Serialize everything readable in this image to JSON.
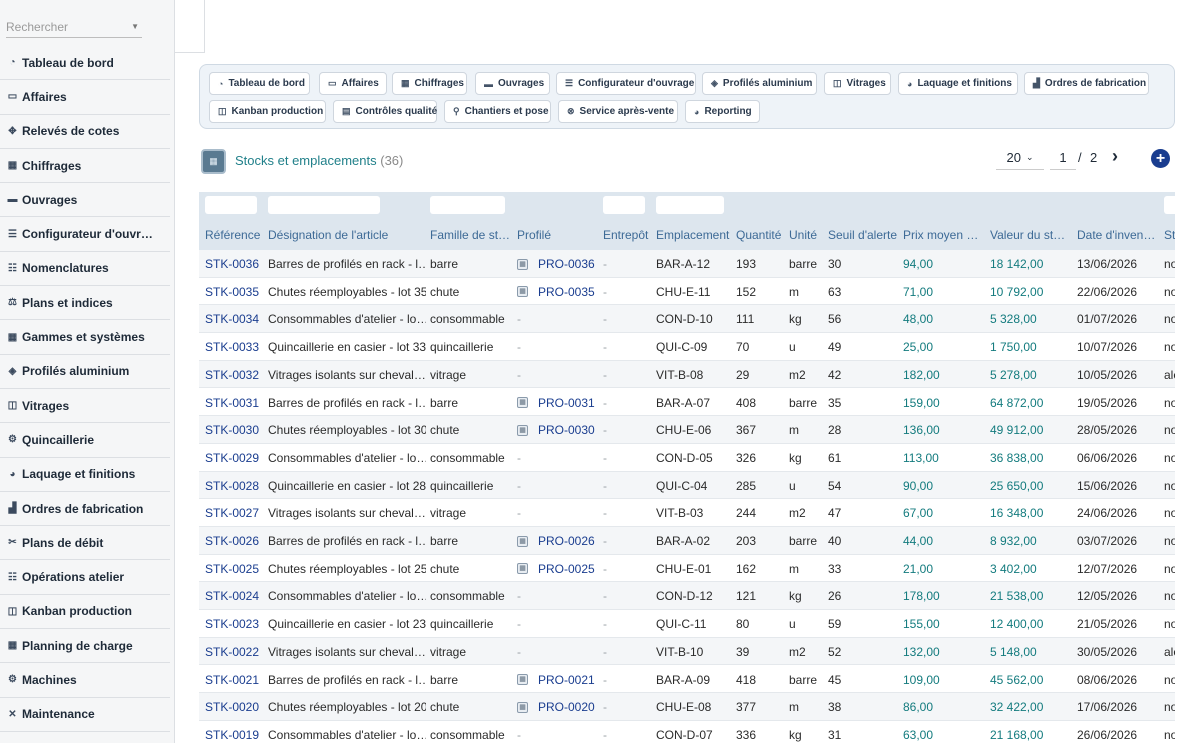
{
  "sidebar": {
    "search_placeholder": "Rechercher",
    "items": [
      {
        "label": "Tableau de bord",
        "icon": "dashboard-icon",
        "glyph": "◔"
      },
      {
        "label": "Affaires",
        "icon": "briefcase-icon",
        "glyph": "▭"
      },
      {
        "label": "Relevés de cotes",
        "icon": "measure-icon",
        "glyph": "✥"
      },
      {
        "label": "Chiffrages",
        "icon": "calculator-icon",
        "glyph": "▦"
      },
      {
        "label": "Ouvrages",
        "icon": "window-icon",
        "glyph": "▬"
      },
      {
        "label": "Configurateur d'ouvr…",
        "icon": "sliders-icon",
        "glyph": "☰"
      },
      {
        "label": "Nomenclatures",
        "icon": "list-icon",
        "glyph": "☷"
      },
      {
        "label": "Plans et indices",
        "icon": "drafting-icon",
        "glyph": "⚖"
      },
      {
        "label": "Gammes et systèmes",
        "icon": "grid-icon",
        "glyph": "▦"
      },
      {
        "label": "Profilés aluminium",
        "icon": "layers-icon",
        "glyph": "◈"
      },
      {
        "label": "Vitrages",
        "icon": "glass-icon",
        "glyph": "◫"
      },
      {
        "label": "Quincaillerie",
        "icon": "cogs-icon",
        "glyph": "⚙"
      },
      {
        "label": "Laquage et finitions",
        "icon": "palette-icon",
        "glyph": "◕"
      },
      {
        "label": "Ordres de fabrication",
        "icon": "factory-icon",
        "glyph": "▟"
      },
      {
        "label": "Plans de débit",
        "icon": "scissors-icon",
        "glyph": "✂"
      },
      {
        "label": "Opérations atelier",
        "icon": "tasks-icon",
        "glyph": "☷"
      },
      {
        "label": "Kanban production",
        "icon": "kanban-icon",
        "glyph": "◫"
      },
      {
        "label": "Planning de charge",
        "icon": "calendar-icon",
        "glyph": "▦"
      },
      {
        "label": "Machines",
        "icon": "cogs-icon",
        "glyph": "⚙"
      },
      {
        "label": "Maintenance",
        "icon": "tools-icon",
        "glyph": "✕"
      }
    ]
  },
  "nav": {
    "row1": [
      {
        "label": "Tableau de bord",
        "icon": "dashboard-icon",
        "glyph": "◔"
      },
      {
        "label": "Affaires",
        "icon": "briefcase-icon",
        "glyph": "▭"
      },
      {
        "label": "Chiffrages",
        "icon": "calculator-icon",
        "glyph": "▦"
      },
      {
        "label": "Ouvrages",
        "icon": "window-icon",
        "glyph": "▬"
      },
      {
        "label": "Configurateur d'ouvrage",
        "icon": "sliders-icon",
        "glyph": "☰"
      },
      {
        "label": "Profilés aluminium",
        "icon": "layers-icon",
        "glyph": "◈"
      },
      {
        "label": "Vitrages",
        "icon": "glass-icon",
        "glyph": "◫"
      },
      {
        "label": "Laquage et finitions",
        "icon": "palette-icon",
        "glyph": "◕"
      },
      {
        "label": "Ordres de fabrication",
        "icon": "factory-icon",
        "glyph": "▟"
      }
    ],
    "row2": [
      {
        "label": "Kanban production",
        "icon": "kanban-icon",
        "glyph": "◫"
      },
      {
        "label": "Contrôles qualité",
        "icon": "clipboard-icon",
        "glyph": "▤"
      },
      {
        "label": "Chantiers et pose",
        "icon": "map-pin-icon",
        "glyph": "⚲"
      },
      {
        "label": "Service après-vente",
        "icon": "support-icon",
        "glyph": "⊗"
      },
      {
        "label": "Reporting",
        "icon": "chart-pie-icon",
        "glyph": "◕"
      }
    ]
  },
  "list": {
    "title": "Stocks et emplacements",
    "count": "(36)",
    "page_size": "20",
    "page_current": "1",
    "page_sep": "/",
    "page_total": "2"
  },
  "table": {
    "headers": [
      "Référence",
      "Désignation de l'article",
      "Famille de st…",
      "Profilé",
      "Entrepôt",
      "Emplacement",
      "Quantité",
      "Unité",
      "Seuil d'alerte",
      "Prix moyen …",
      "Valeur du st…",
      "Date d'inven…",
      "St"
    ],
    "rows": [
      {
        "ref": "STK-0036",
        "des": "Barres de profilés en rack - l…",
        "fam": "barre",
        "prof": "PRO-0036",
        "ent": "-",
        "emp": "BAR-A-12",
        "qte": "193",
        "unit": "barre",
        "seuil": "30",
        "prix": "94,00",
        "val": "18 142,00",
        "date": "13/06/2026",
        "st": "no"
      },
      {
        "ref": "STK-0035",
        "des": "Chutes réemployables - lot 35",
        "fam": "chute",
        "prof": "PRO-0035",
        "ent": "-",
        "emp": "CHU-E-11",
        "qte": "152",
        "unit": "m",
        "seuil": "63",
        "prix": "71,00",
        "val": "10 792,00",
        "date": "22/06/2026",
        "st": "no"
      },
      {
        "ref": "STK-0034",
        "des": "Consommables d'atelier - lo…",
        "fam": "consommable",
        "prof": "-",
        "ent": "-",
        "emp": "CON-D-10",
        "qte": "111",
        "unit": "kg",
        "seuil": "56",
        "prix": "48,00",
        "val": "5 328,00",
        "date": "01/07/2026",
        "st": "no"
      },
      {
        "ref": "STK-0033",
        "des": "Quincaillerie en casier - lot 33",
        "fam": "quincaillerie",
        "prof": "-",
        "ent": "-",
        "emp": "QUI-C-09",
        "qte": "70",
        "unit": "u",
        "seuil": "49",
        "prix": "25,00",
        "val": "1 750,00",
        "date": "10/07/2026",
        "st": "no"
      },
      {
        "ref": "STK-0032",
        "des": "Vitrages isolants sur cheval…",
        "fam": "vitrage",
        "prof": "-",
        "ent": "-",
        "emp": "VIT-B-08",
        "qte": "29",
        "unit": "m2",
        "seuil": "42",
        "prix": "182,00",
        "val": "5 278,00",
        "date": "10/05/2026",
        "st": "ale"
      },
      {
        "ref": "STK-0031",
        "des": "Barres de profilés en rack - l…",
        "fam": "barre",
        "prof": "PRO-0031",
        "ent": "-",
        "emp": "BAR-A-07",
        "qte": "408",
        "unit": "barre",
        "seuil": "35",
        "prix": "159,00",
        "val": "64 872,00",
        "date": "19/05/2026",
        "st": "no"
      },
      {
        "ref": "STK-0030",
        "des": "Chutes réemployables - lot 30",
        "fam": "chute",
        "prof": "PRO-0030",
        "ent": "-",
        "emp": "CHU-E-06",
        "qte": "367",
        "unit": "m",
        "seuil": "28",
        "prix": "136,00",
        "val": "49 912,00",
        "date": "28/05/2026",
        "st": "no"
      },
      {
        "ref": "STK-0029",
        "des": "Consommables d'atelier - lo…",
        "fam": "consommable",
        "prof": "-",
        "ent": "-",
        "emp": "CON-D-05",
        "qte": "326",
        "unit": "kg",
        "seuil": "61",
        "prix": "113,00",
        "val": "36 838,00",
        "date": "06/06/2026",
        "st": "no"
      },
      {
        "ref": "STK-0028",
        "des": "Quincaillerie en casier - lot 28",
        "fam": "quincaillerie",
        "prof": "-",
        "ent": "-",
        "emp": "QUI-C-04",
        "qte": "285",
        "unit": "u",
        "seuil": "54",
        "prix": "90,00",
        "val": "25 650,00",
        "date": "15/06/2026",
        "st": "no"
      },
      {
        "ref": "STK-0027",
        "des": "Vitrages isolants sur cheval…",
        "fam": "vitrage",
        "prof": "-",
        "ent": "-",
        "emp": "VIT-B-03",
        "qte": "244",
        "unit": "m2",
        "seuil": "47",
        "prix": "67,00",
        "val": "16 348,00",
        "date": "24/06/2026",
        "st": "no"
      },
      {
        "ref": "STK-0026",
        "des": "Barres de profilés en rack - l…",
        "fam": "barre",
        "prof": "PRO-0026",
        "ent": "-",
        "emp": "BAR-A-02",
        "qte": "203",
        "unit": "barre",
        "seuil": "40",
        "prix": "44,00",
        "val": "8 932,00",
        "date": "03/07/2026",
        "st": "no"
      },
      {
        "ref": "STK-0025",
        "des": "Chutes réemployables - lot 25",
        "fam": "chute",
        "prof": "PRO-0025",
        "ent": "-",
        "emp": "CHU-E-01",
        "qte": "162",
        "unit": "m",
        "seuil": "33",
        "prix": "21,00",
        "val": "3 402,00",
        "date": "12/07/2026",
        "st": "no"
      },
      {
        "ref": "STK-0024",
        "des": "Consommables d'atelier - lo…",
        "fam": "consommable",
        "prof": "-",
        "ent": "-",
        "emp": "CON-D-12",
        "qte": "121",
        "unit": "kg",
        "seuil": "26",
        "prix": "178,00",
        "val": "21 538,00",
        "date": "12/05/2026",
        "st": "no"
      },
      {
        "ref": "STK-0023",
        "des": "Quincaillerie en casier - lot 23",
        "fam": "quincaillerie",
        "prof": "-",
        "ent": "-",
        "emp": "QUI-C-11",
        "qte": "80",
        "unit": "u",
        "seuil": "59",
        "prix": "155,00",
        "val": "12 400,00",
        "date": "21/05/2026",
        "st": "no"
      },
      {
        "ref": "STK-0022",
        "des": "Vitrages isolants sur cheval…",
        "fam": "vitrage",
        "prof": "-",
        "ent": "-",
        "emp": "VIT-B-10",
        "qte": "39",
        "unit": "m2",
        "seuil": "52",
        "prix": "132,00",
        "val": "5 148,00",
        "date": "30/05/2026",
        "st": "ale"
      },
      {
        "ref": "STK-0021",
        "des": "Barres de profilés en rack - l…",
        "fam": "barre",
        "prof": "PRO-0021",
        "ent": "-",
        "emp": "BAR-A-09",
        "qte": "418",
        "unit": "barre",
        "seuil": "45",
        "prix": "109,00",
        "val": "45 562,00",
        "date": "08/06/2026",
        "st": "no"
      },
      {
        "ref": "STK-0020",
        "des": "Chutes réemployables - lot 20",
        "fam": "chute",
        "prof": "PRO-0020",
        "ent": "-",
        "emp": "CHU-E-08",
        "qte": "377",
        "unit": "m",
        "seuil": "38",
        "prix": "86,00",
        "val": "32 422,00",
        "date": "17/06/2026",
        "st": "no"
      },
      {
        "ref": "STK-0019",
        "des": "Consommables d'atelier - lo…",
        "fam": "consommable",
        "prof": "-",
        "ent": "-",
        "emp": "CON-D-07",
        "qte": "336",
        "unit": "kg",
        "seuil": "31",
        "prix": "63,00",
        "val": "21 168,00",
        "date": "26/06/2026",
        "st": "no"
      }
    ]
  },
  "colors": {
    "accent": "#21808a",
    "link": "#1a3d8f",
    "money": "#137b7e",
    "header_bg": "#dde6ee"
  }
}
